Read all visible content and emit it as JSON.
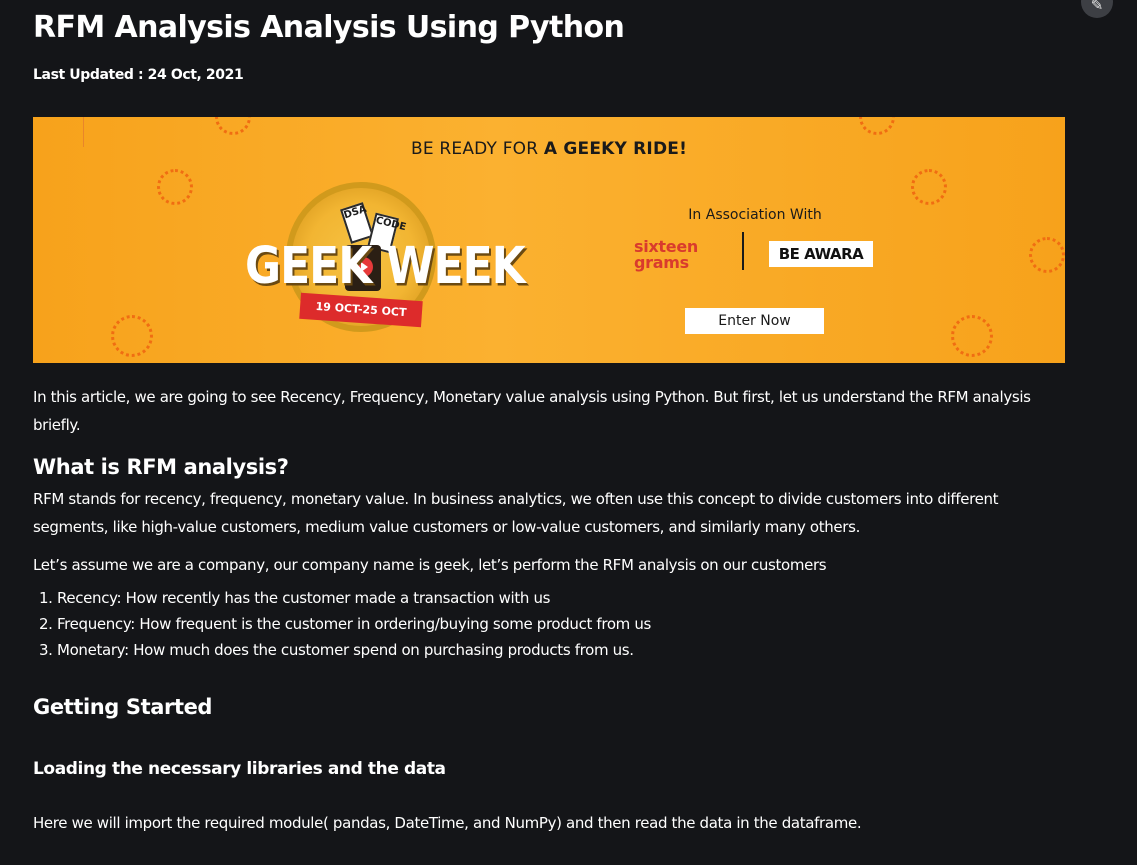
{
  "article": {
    "title": "RFM Analysis Analysis Using Python",
    "last_updated": "Last Updated : 24 Oct, 2021"
  },
  "banner": {
    "headline_prefix": "BE READY FOR ",
    "headline_bold": "A GEEKY RIDE!",
    "event_word_left": "GEEK",
    "event_word_right": "WEEK",
    "ticket_1": "DSA",
    "ticket_2": "CODE",
    "dates": "19 OCT-25 OCT",
    "association": "In Association With",
    "sponsor_1_line1": "sixteen",
    "sponsor_1_line2": "grams",
    "sponsor_2": "BE AWARA",
    "cta": "Enter Now",
    "colors": {
      "background": "#f7a21b",
      "accent": "#d93b2d"
    }
  },
  "intro": "In this article, we are going to see Recency, Frequency, Monetary value analysis using Python. But first, let us understand the RFM analysis briefly.",
  "section_what": {
    "heading": "What is RFM analysis?",
    "paragraph": "RFM stands for recency, frequency, monetary value. In business analytics, we often use this concept to divide customers into different segments, like high-value customers, medium value customers or low-value customers, and similarly many others.",
    "assume": "Let’s assume we are a company, our company name is geek, let’s perform the RFM analysis on our customers",
    "list": [
      "Recency: How recently has the customer made a transaction with us",
      "Frequency: How frequent is the customer in ordering/buying some product from us",
      "Monetary: How much does the customer spend on purchasing products from us."
    ]
  },
  "section_start": {
    "heading": "Getting Started",
    "subheading": "Loading the necessary libraries and the data",
    "paragraph": "Here we will import the required module( pandas, DateTime, and NumPy) and then read the data in the dataframe."
  },
  "toolbar": {
    "edit_icon": "pencil-icon"
  },
  "theme": {
    "page_background": "#141518",
    "text": "#ffffff"
  }
}
